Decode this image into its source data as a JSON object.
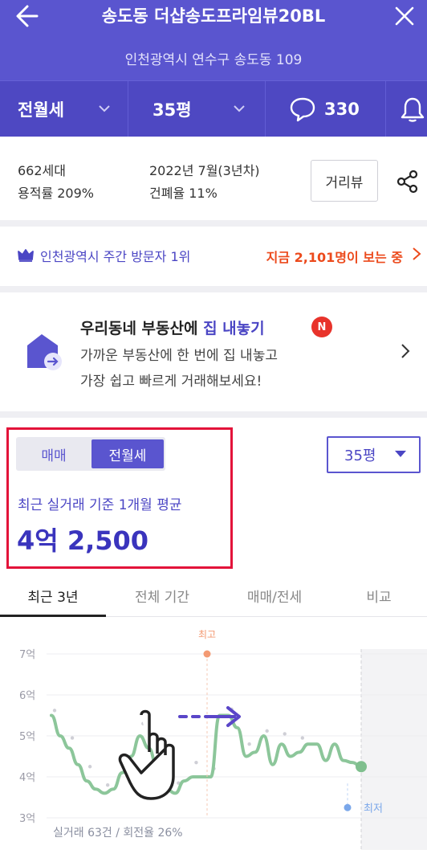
{
  "header": {
    "title": "송도동 더샵송도프라임뷰20BL",
    "address": "인천광역시 연수구 송도동 109",
    "deal_type": "전월세",
    "size": "35평",
    "comment_count": "330"
  },
  "info": {
    "households": "662세대",
    "floor_area_ratio": "용적률 209%",
    "completion": "2022년 7월(3년차)",
    "building_coverage": "건폐율 11%",
    "distance_view_label": "거리뷰"
  },
  "visitor": {
    "rank_text": "인천광역시 주간 방문자 1위",
    "viewing_text": "지금 2,101명이 보는 중"
  },
  "promo": {
    "title_prefix": "우리동네 부동산에 ",
    "title_highlight": "집 내놓기",
    "badge": "N",
    "line1": "가까운 부동산에 한 번에 집 내놓고",
    "line2": "가장 쉽고 빠르게 거래해보세요!"
  },
  "price": {
    "seg_sale": "매매",
    "seg_rent": "전월세",
    "size_select": "35평",
    "avg_label": "최근 실거래 기준 1개월 평균",
    "avg_value": "4억 2,500"
  },
  "tabs": [
    "최근 3년",
    "전체 기간",
    "매매/전세",
    "비교"
  ],
  "chart_data": {
    "type": "line",
    "y_ticks": [
      "7억",
      "6억",
      "5억",
      "4억",
      "3억"
    ],
    "ylim": [
      3,
      7
    ],
    "series": [
      {
        "values": [
          5.5,
          5.0,
          4.7,
          4.3,
          3.9,
          3.7,
          3.6,
          3.7,
          4.1,
          4.5,
          5.0,
          4.7,
          4.2,
          3.7,
          3.6,
          3.9,
          4.0,
          4.0,
          4.0,
          5.5,
          5.5,
          5.2,
          4.5,
          4.6,
          5.0,
          4.3,
          4.8,
          4.5,
          4.6,
          4.8,
          4.8,
          4.4,
          4.8,
          4.4,
          4.35,
          4.25
        ]
      }
    ],
    "max_label": "최고",
    "max_value": 7.0,
    "min_label": "최저",
    "min_value": 3.25,
    "footer": "실거래 63건 / 회전율 26%",
    "colors": {
      "line": "#8cc69a",
      "max": "#f39a73",
      "min": "#7aa7ea",
      "end_dot": "#7fbf8e"
    }
  }
}
